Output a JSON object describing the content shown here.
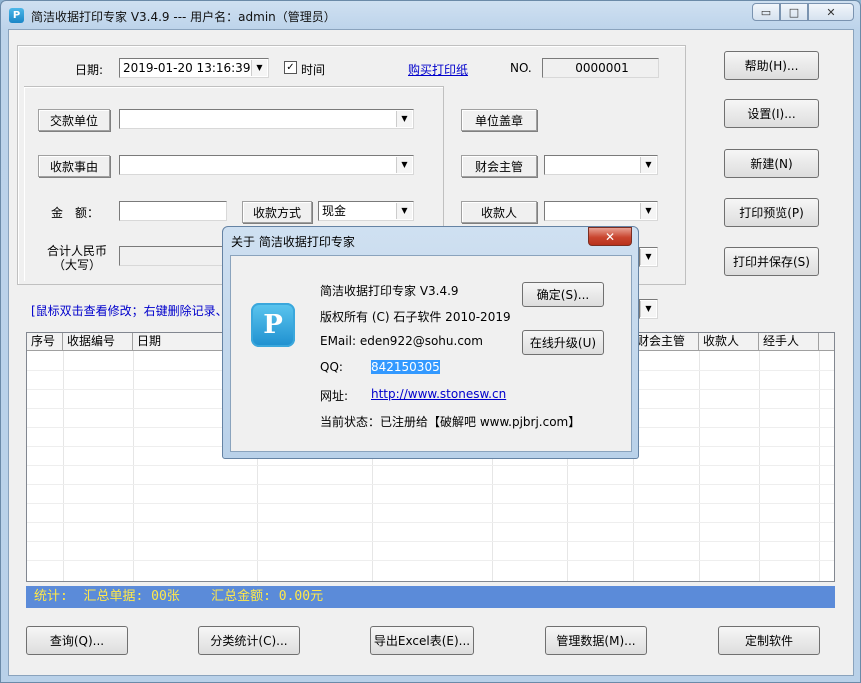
{
  "window": {
    "title": "简洁收据打印专家 V3.4.9 --- 用户名：admin（管理员）",
    "icon_letter": "P"
  },
  "form": {
    "date_label": "日期:",
    "date_value": "2019-01-20 13:16:39",
    "time_checkbox_label": "时间",
    "time_checked": true,
    "buy_paper_link": "购买打印纸",
    "no_label": "NO.",
    "no_value": "0000001",
    "payer_label": "交款单位",
    "payer_value": "",
    "reason_label": "收款事由",
    "reason_value": "",
    "amount_label": "金　额：",
    "amount_value": "",
    "method_label": "收款方式",
    "method_value": "现金",
    "rmb_label_line1": "合计人民币",
    "rmb_label_line2": "（大写）",
    "seal_label": "单位盖章",
    "accountant_label": "财会主管",
    "accountant_value": "",
    "payee_label": "收款人",
    "payee_value": ""
  },
  "right_buttons": [
    "帮助(H)...",
    "设置(I)...",
    "新建(N)",
    "打印预览(P)",
    "打印并保存(S)"
  ],
  "hint": "[鼠标双击查看修改；右键删除记录、",
  "table": {
    "columns": [
      "序号",
      "收据编号",
      "日期",
      "财会主管",
      "收款人",
      "经手人"
    ]
  },
  "stats": {
    "label": "统计:",
    "count_text": "汇总单据: 00张",
    "amount_text": "汇总金额: 0.00元"
  },
  "bottom_buttons": [
    "查询(Q)...",
    "分类统计(C)...",
    "导出Excel表(E)...",
    "管理数据(M)...",
    "定制软件"
  ],
  "about": {
    "title": "关于 简洁收据打印专家",
    "close_glyph": "✕",
    "logo_letter": "P",
    "app_name": "简洁收据打印专家 V3.4.9",
    "copyright": "版权所有 (C) 石子软件 2010-2019",
    "email": "EMail:  eden922@sohu.com",
    "qq_label": "QQ:",
    "qq_value": "842150305",
    "site_label": "网址:",
    "site_value": "http://www.stonesw.cn",
    "status": "当前状态：已注册给【破解吧 www.pjbrj.com】",
    "ok_button": "确定(S)...",
    "upgrade_button": "在线升级(U)"
  },
  "colors": {
    "stats_bg": "#5b8bd9",
    "stats_fg": "#ffe84a",
    "link": "#0000cc",
    "selection": "#3399ff"
  }
}
